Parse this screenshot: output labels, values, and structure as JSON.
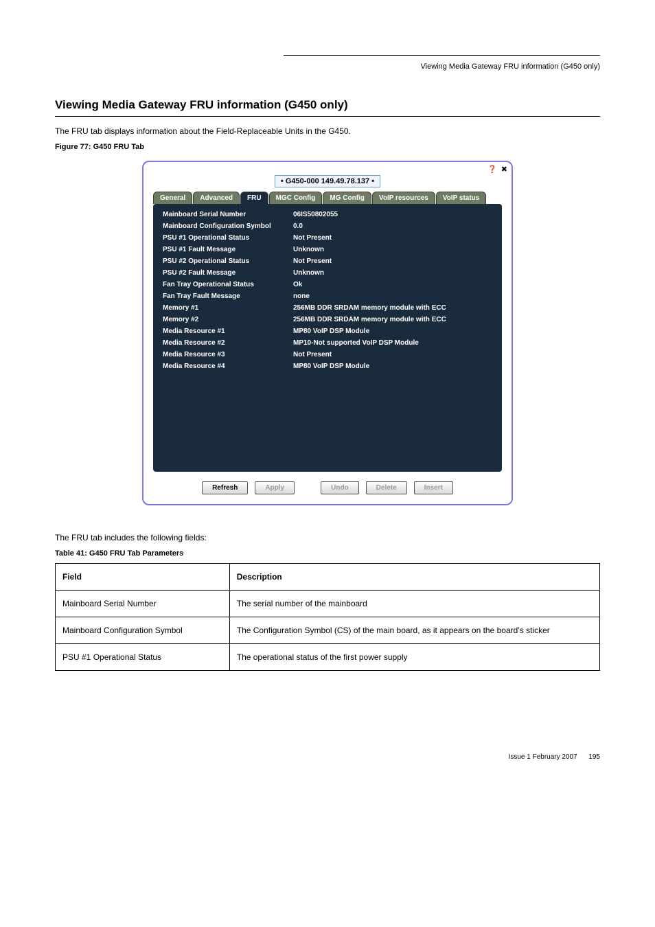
{
  "running_head": "Viewing Media Gateway FRU information (G450 only)",
  "section_heading": "Viewing Media Gateway FRU information (G450 only)",
  "intro_para": "The FRU tab displays information about the Field-Replaceable Units in the G450.",
  "figure_caption": "Figure 77: G450 FRU Tab",
  "screenshot": {
    "title_pill": "• G450-000 149.49.78.137 •",
    "icons": {
      "help": "❓",
      "close": "✖"
    },
    "tabs": [
      "General",
      "Advanced",
      "FRU",
      "MGC Config",
      "MG Config",
      "VoIP resources",
      "VoIP status"
    ],
    "active_tab_index": 2,
    "rows": [
      {
        "label": "Mainboard Serial Number",
        "value": "06IS50802055"
      },
      {
        "label": "Mainboard Configuration Symbol",
        "value": "0.0"
      },
      {
        "label": "PSU #1 Operational Status",
        "value": "Not Present"
      },
      {
        "label": "PSU #1 Fault Message",
        "value": "Unknown"
      },
      {
        "label": "PSU #2 Operational Status",
        "value": "Not Present"
      },
      {
        "label": "PSU #2 Fault Message",
        "value": "Unknown"
      },
      {
        "label": "Fan Tray Operational Status",
        "value": "Ok"
      },
      {
        "label": "Fan Tray Fault Message",
        "value": "none"
      },
      {
        "label": "Memory #1",
        "value": "256MB DDR SRDAM memory module with ECC"
      },
      {
        "label": "Memory #2",
        "value": "256MB DDR SRDAM memory module with ECC"
      },
      {
        "label": "Media Resource #1",
        "value": "MP80 VoIP DSP Module"
      },
      {
        "label": "Media Resource #2",
        "value": "MP10-Not supported VoIP DSP Module"
      },
      {
        "label": "Media Resource #3",
        "value": "Not Present"
      },
      {
        "label": "Media Resource #4",
        "value": "MP80 VoIP DSP Module"
      }
    ],
    "buttons": [
      {
        "label": "Refresh",
        "disabled": false
      },
      {
        "label": "Apply",
        "disabled": true
      },
      {
        "label": "Undo",
        "disabled": true
      },
      {
        "label": "Delete",
        "disabled": true
      },
      {
        "label": "Insert",
        "disabled": true
      }
    ]
  },
  "table_intro": "The FRU tab includes the following fields:",
  "table_caption": "Table 41: G450 FRU Tab Parameters",
  "table": {
    "headers": [
      "Field",
      "Description"
    ],
    "rows": [
      [
        "Mainboard Serial Number",
        "The serial number of the mainboard"
      ],
      [
        "Mainboard Configuration Symbol",
        "The Configuration Symbol (CS) of the main board, as it appears on the board’s sticker"
      ],
      [
        "PSU #1 Operational Status",
        "The operational status of the first power supply"
      ]
    ]
  },
  "footer": {
    "left": "Issue 1   February 2007",
    "right": "195"
  }
}
